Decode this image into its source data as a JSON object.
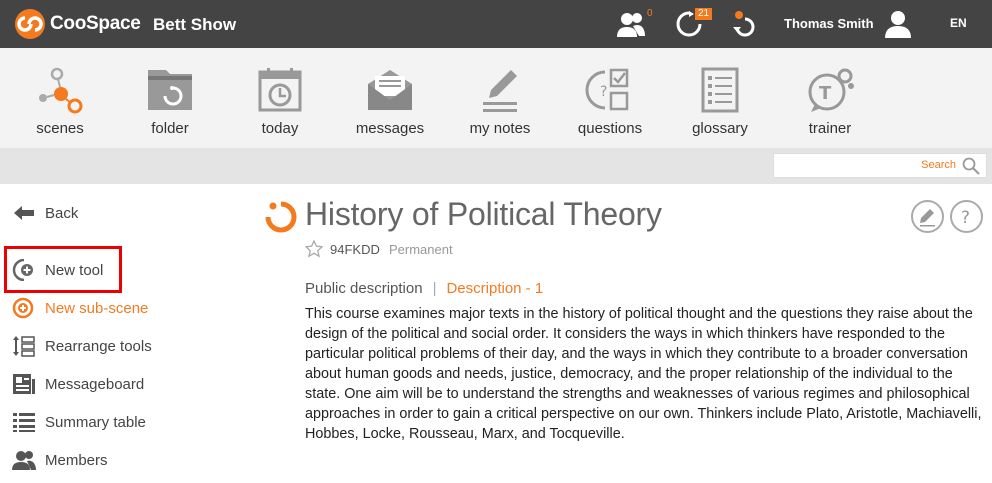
{
  "topbar": {
    "brand": "CooSpace",
    "scene_title": "Bett Show",
    "members_count": "0",
    "activity_count": "21",
    "user_name": "Thomas Smith",
    "language": "EN"
  },
  "toolbar": {
    "tools": [
      {
        "label": "scenes",
        "icon": "scenes-icon"
      },
      {
        "label": "folder",
        "icon": "folder-icon"
      },
      {
        "label": "today",
        "icon": "calendar-icon"
      },
      {
        "label": "messages",
        "icon": "envelope-icon"
      },
      {
        "label": "my notes",
        "icon": "pencil-icon"
      },
      {
        "label": "questions",
        "icon": "questions-icon"
      },
      {
        "label": "glossary",
        "icon": "glossary-icon"
      },
      {
        "label": "trainer",
        "icon": "trainer-icon"
      }
    ]
  },
  "search": {
    "label": "Search"
  },
  "sidebar": {
    "items": [
      {
        "label": "Back"
      },
      {
        "label": "New tool"
      },
      {
        "label": "New sub-scene"
      },
      {
        "label": "Rearrange tools"
      },
      {
        "label": "Messageboard"
      },
      {
        "label": "Summary table"
      },
      {
        "label": "Members"
      }
    ]
  },
  "main": {
    "title": "History of Political Theory",
    "code": "94FKDD",
    "status": "Permanent",
    "tabs": {
      "public": "Public description",
      "separator": "|",
      "description": "Description - 1"
    },
    "description": "This course examines major texts in the history of political thought and the questions they raise about the design of the political and social order. It considers the ways in which thinkers have responded to the particular political problems of their day, and the ways in which they contribute to a broader conversation about human goods and needs, justice, democracy, and the proper relationship of the individual to the state. One aim will be to understand the strengths and weaknesses of various regimes and philosophical approaches in order to gain a critical perspective on our own. Thinkers include Plato, Aristotle, Machiavelli, Hobbes, Locke, Rousseau, Marx, and Tocqueville."
  },
  "colors": {
    "accent": "#f47a20",
    "topbar": "#444444",
    "toolbar": "#f3f3f3",
    "highlight": "#ee0000"
  }
}
